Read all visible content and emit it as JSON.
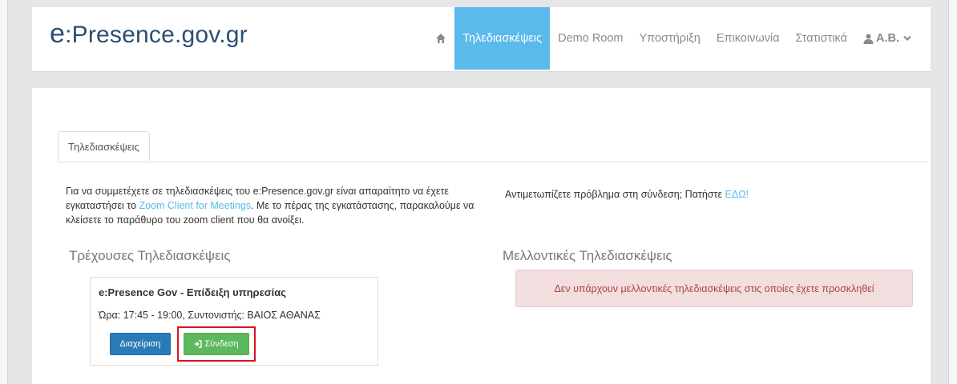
{
  "header": {
    "logo_prefix": "e",
    "logo_rest": ":Presence.gov.gr",
    "nav": {
      "home_icon": "home-icon",
      "items": [
        "Τηλεδιασκέψεις",
        "Demo Room",
        "Υποστήριξη",
        "Επικοινωνία",
        "Στατιστικά"
      ],
      "active_index": 0,
      "user_label": "Α.Β.",
      "user_icon": "user-icon",
      "dropdown_icon": "chevron-down-icon"
    }
  },
  "main": {
    "tab_label": "Τηλεδιασκέψεις",
    "intro": {
      "text1": "Για να συμμετέχετε σε τηλεδιασκέψεις του e:Presence.gov.gr είναι απαραίτητο να έχετε εγκαταστήσει το ",
      "link": "Zoom Client for Meetings",
      "text2": ". Με το πέρας της εγκατάστασης, παρακαλούμε να κλείσετε το παράθυρο του zoom client που θα ανοίξει."
    },
    "problem": {
      "text": "Αντιμετωπίζετε πρόβλημα στη σύνδεση; Πατήστε ",
      "link": "ΕΔΩ!"
    },
    "current_title": "Τρέχουσες Τηλεδιασκέψεις",
    "future_title": "Μελλοντικές Τηλεδιασκέψεις",
    "meeting": {
      "title": "e:Presence Gov - Επίδειξη υπηρεσίας",
      "time": "Ώρα: 17:45 - 19:00, Συντονιστής: ΒΑΙΟΣ ΑΘΑΝΑΣ",
      "manage_label": "Διαχείριση",
      "join_label": "Σύνδεση",
      "join_icon": "sign-in-icon"
    },
    "future_empty_message": "Δεν υπάρχουν μελλοντικές τηλεδιασκέψεις στις οποίες έχετε προσκληθεί"
  },
  "colors": {
    "accent": "#5bb9ec",
    "logo": "#2b4f73",
    "manage_button": "#2a7ab8",
    "join_button": "#5cb85c",
    "alert_bg": "#f2dede",
    "alert_text": "#a94442",
    "highlight": "#d7141d"
  }
}
